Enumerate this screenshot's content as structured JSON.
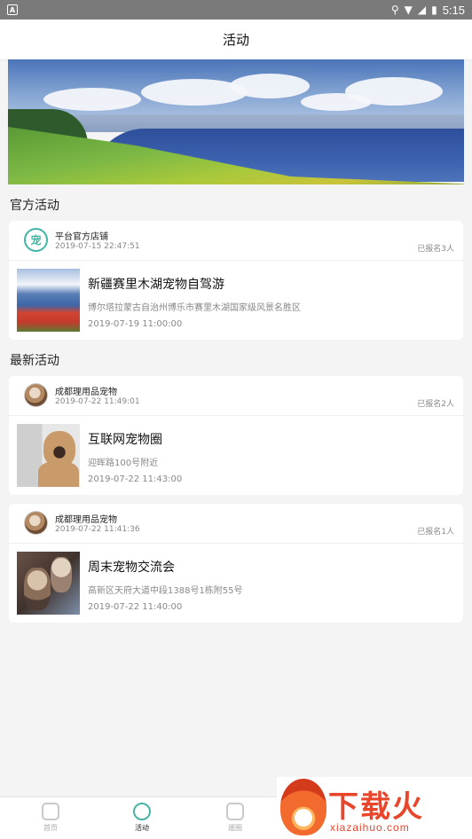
{
  "status_bar": {
    "time": "5:15",
    "app_icon": "A"
  },
  "app_bar": {
    "title": "活动"
  },
  "sections": {
    "official": "官方活动",
    "latest": "最新活动"
  },
  "official_card": {
    "shop": "平台官方店铺",
    "post_time": "2019-07-15 22:47:51",
    "signup": "已报名3人",
    "logo_text": "宠",
    "title": "新疆赛里木湖宠物自驾游",
    "address": "博尔塔拉蒙古自治州博乐市赛里木湖国家级风景名胜区",
    "event_time": "2019-07-19 11:00:00"
  },
  "latest_cards": [
    {
      "shop": "成都理用品宠物",
      "post_time": "2019-07-22 11:49:01",
      "signup": "已报名2人",
      "title": "互联网宠物圈",
      "address": "迎晖路100号附近",
      "event_time": "2019-07-22 11:43:00"
    },
    {
      "shop": "成都理用品宠物",
      "post_time": "2019-07-22 11:41:36",
      "signup": "已报名1人",
      "title": "周末宠物交流会",
      "address": "高新区天府大道中段1388号1栋附55号",
      "event_time": "2019-07-22 11:40:00"
    }
  ],
  "tabs": [
    {
      "label": "首页",
      "icon": "home-icon"
    },
    {
      "label": "活动",
      "icon": "basketball-icon"
    },
    {
      "label": "遛圈",
      "icon": "circle-icon"
    }
  ],
  "watermark": {
    "text": "下载火",
    "url": "xiazaihuo.com"
  },
  "colors": {
    "accent": "#49b3a5",
    "brand_logo": "#3fb5a2",
    "watermark": "#e8452a"
  }
}
